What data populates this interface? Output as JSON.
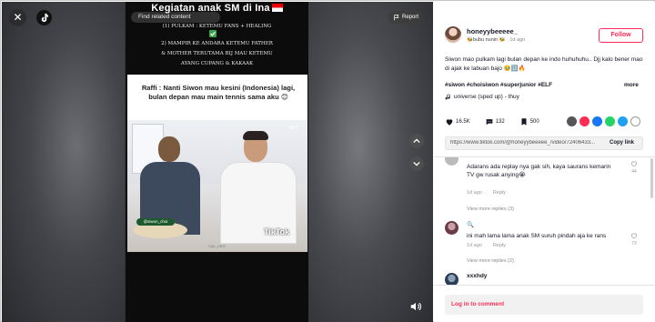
{
  "video": {
    "title": "Kegiatan anak SM di Ina",
    "search_placeholder": "Find related content",
    "overlay_lines": [
      "(1) PULKAM : KETEMU FANS + HEALING",
      "2) MAMPIR KE ANDARA KETEMU FATHER",
      "& MOTHER TERUTAMA BIJ MAU KETEMU",
      "AYANG CUPANG & KAKAAK"
    ],
    "caption": "Raffi : Nanti Siwon mau kesini (Indonesia) lagi, bulan depan mau main tennis sama aku 😊",
    "cake_tag": "@siwon_choi",
    "watermark": "TikTok",
    "net_logo": "NET",
    "handle_text": "tuju_rans"
  },
  "controls": {
    "close": "✕",
    "report_label": "Report"
  },
  "author": {
    "username": "honeyybeeeee_",
    "display_name": "🐝bubu nunin 🐝",
    "time": "1d ago",
    "follow_label": "Follow"
  },
  "post": {
    "description": "Siwon mao pulkam lagi bulan depan ke indo huhuhuhu.. Djj kalo bener mao di ajak ke labuan bajo 🥹🔢🔥",
    "tags": "#siwon #choisiwon #superjunior #ELF",
    "more_label": "more",
    "music": "universe (sped up) - thuy"
  },
  "stats": {
    "likes": "16.5K",
    "comments": "132",
    "saves": "500"
  },
  "share_colors": [
    "#fe2c55",
    "#fe2c55",
    "#1877f2",
    "#25d366",
    "#1da1f2",
    "#777"
  ],
  "link": {
    "url": "https://www.tiktok.com/@honeyybeeeee_/video/72406433...",
    "copy_label": "Copy link"
  },
  "comments": [
    {
      "name": "",
      "text": "Adarans ada replay nya gak sih, kaya saurans kemarin\nTV gw rusak anying😭",
      "time": "1d ago",
      "reply_label": "Reply",
      "likes": "44",
      "view_more": "View more replies (3)"
    },
    {
      "name": "🔍",
      "text": "ini mah lama lama anak SM suruh pindah aja ke rans",
      "time": "1d ago",
      "reply_label": "Reply",
      "likes": "73",
      "view_more": "View more replies (2)"
    },
    {
      "name": "xxxhdy",
      "text": "",
      "time": "",
      "reply_label": "",
      "likes": "",
      "view_more": ""
    }
  ],
  "login": {
    "label": "Log in to comment"
  },
  "colors": {
    "brand": "#fe2c55",
    "text": "#161823"
  }
}
